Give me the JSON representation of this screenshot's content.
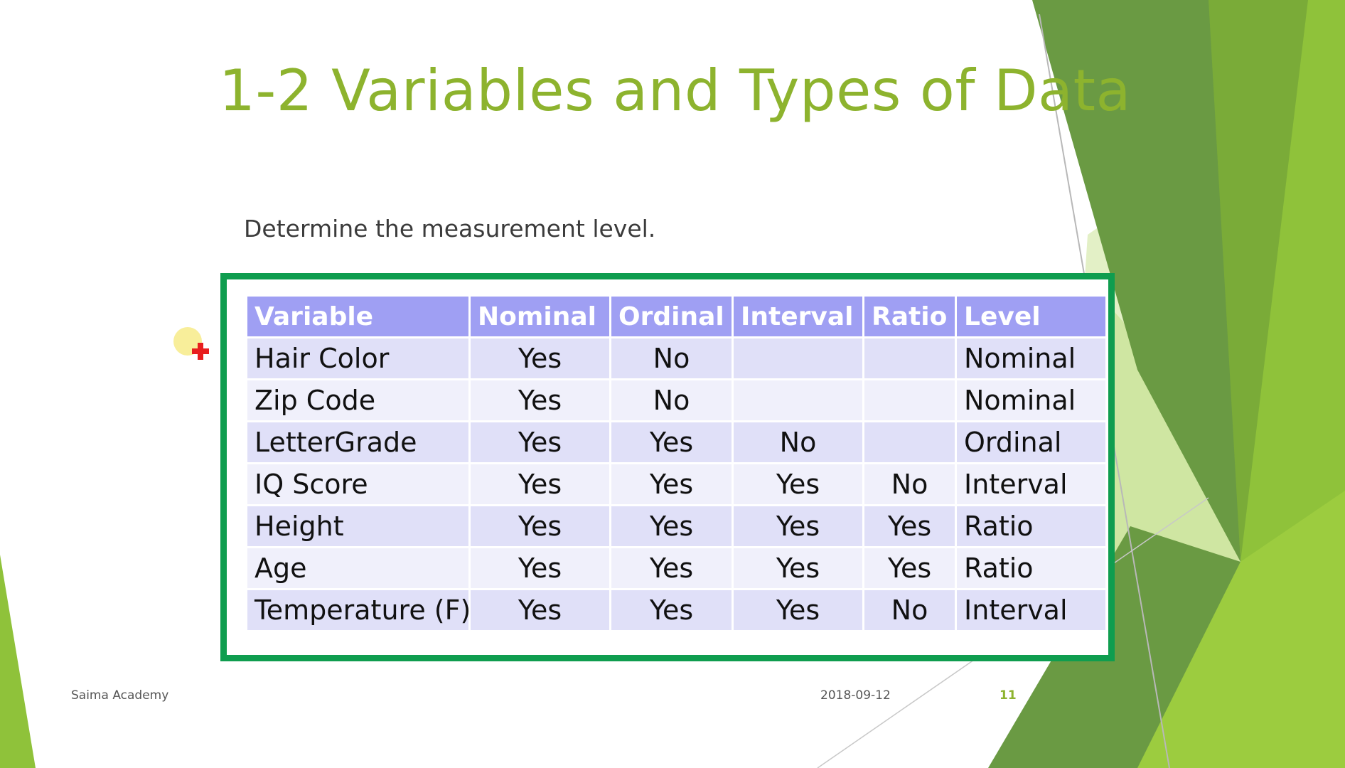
{
  "slide": {
    "title": "1-2 Variables and Types of Data",
    "subtitle": "Determine the measurement level.",
    "footer_left": "Saima Academy",
    "footer_date": "2018-09-12",
    "page_number": "11"
  },
  "table": {
    "headers": [
      "Variable",
      "Nominal",
      "Ordinal",
      "Interval",
      "Ratio",
      "Level"
    ],
    "rows": [
      [
        "Hair Color",
        "Yes",
        "No",
        "",
        "",
        "Nominal"
      ],
      [
        "Zip Code",
        "Yes",
        "No",
        "",
        "",
        "Nominal"
      ],
      [
        "LetterGrade",
        "Yes",
        "Yes",
        "No",
        "",
        "Ordinal"
      ],
      [
        "IQ Score",
        "Yes",
        "Yes",
        "Yes",
        "No",
        "Interval"
      ],
      [
        "Height",
        "Yes",
        "Yes",
        "Yes",
        "Yes",
        "Ratio"
      ],
      [
        "Age",
        "Yes",
        "Yes",
        "Yes",
        "Yes",
        "Ratio"
      ],
      [
        "Temperature (F)",
        "Yes",
        "Yes",
        "Yes",
        "No",
        "Interval"
      ]
    ]
  },
  "colors": {
    "title": "#8db32e",
    "table_border": "#0f9d4f",
    "header_fill": "#9f9ff3",
    "row_band": "#e0e0f8",
    "row_plain": "#f0f0fb",
    "decor_green_dark": "#5f8f3a",
    "decor_green_light": "#8fc23a",
    "decor_green_pale": "#cfe6a2"
  },
  "icons": {
    "pointer": "cursor-highlight-icon",
    "cursor": "red-plus-cursor-icon"
  }
}
